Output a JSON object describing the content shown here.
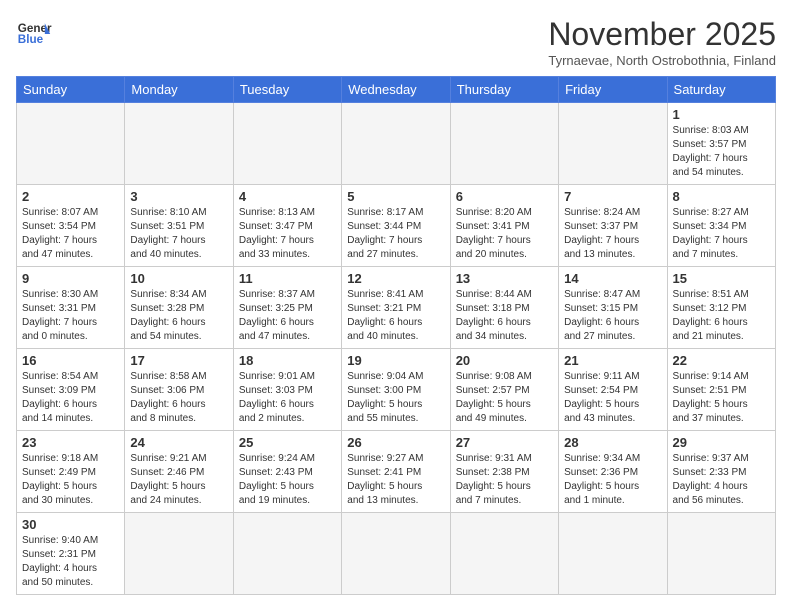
{
  "logo": {
    "text_general": "General",
    "text_blue": "Blue"
  },
  "title": "November 2025",
  "subtitle": "Tyrnaevae, North Ostrobothnia, Finland",
  "days_of_week": [
    "Sunday",
    "Monday",
    "Tuesday",
    "Wednesday",
    "Thursday",
    "Friday",
    "Saturday"
  ],
  "weeks": [
    [
      {
        "day": "",
        "info": ""
      },
      {
        "day": "",
        "info": ""
      },
      {
        "day": "",
        "info": ""
      },
      {
        "day": "",
        "info": ""
      },
      {
        "day": "",
        "info": ""
      },
      {
        "day": "",
        "info": ""
      },
      {
        "day": "1",
        "info": "Sunrise: 8:03 AM\nSunset: 3:57 PM\nDaylight: 7 hours\nand 54 minutes."
      }
    ],
    [
      {
        "day": "2",
        "info": "Sunrise: 8:07 AM\nSunset: 3:54 PM\nDaylight: 7 hours\nand 47 minutes."
      },
      {
        "day": "3",
        "info": "Sunrise: 8:10 AM\nSunset: 3:51 PM\nDaylight: 7 hours\nand 40 minutes."
      },
      {
        "day": "4",
        "info": "Sunrise: 8:13 AM\nSunset: 3:47 PM\nDaylight: 7 hours\nand 33 minutes."
      },
      {
        "day": "5",
        "info": "Sunrise: 8:17 AM\nSunset: 3:44 PM\nDaylight: 7 hours\nand 27 minutes."
      },
      {
        "day": "6",
        "info": "Sunrise: 8:20 AM\nSunset: 3:41 PM\nDaylight: 7 hours\nand 20 minutes."
      },
      {
        "day": "7",
        "info": "Sunrise: 8:24 AM\nSunset: 3:37 PM\nDaylight: 7 hours\nand 13 minutes."
      },
      {
        "day": "8",
        "info": "Sunrise: 8:27 AM\nSunset: 3:34 PM\nDaylight: 7 hours\nand 7 minutes."
      }
    ],
    [
      {
        "day": "9",
        "info": "Sunrise: 8:30 AM\nSunset: 3:31 PM\nDaylight: 7 hours\nand 0 minutes."
      },
      {
        "day": "10",
        "info": "Sunrise: 8:34 AM\nSunset: 3:28 PM\nDaylight: 6 hours\nand 54 minutes."
      },
      {
        "day": "11",
        "info": "Sunrise: 8:37 AM\nSunset: 3:25 PM\nDaylight: 6 hours\nand 47 minutes."
      },
      {
        "day": "12",
        "info": "Sunrise: 8:41 AM\nSunset: 3:21 PM\nDaylight: 6 hours\nand 40 minutes."
      },
      {
        "day": "13",
        "info": "Sunrise: 8:44 AM\nSunset: 3:18 PM\nDaylight: 6 hours\nand 34 minutes."
      },
      {
        "day": "14",
        "info": "Sunrise: 8:47 AM\nSunset: 3:15 PM\nDaylight: 6 hours\nand 27 minutes."
      },
      {
        "day": "15",
        "info": "Sunrise: 8:51 AM\nSunset: 3:12 PM\nDaylight: 6 hours\nand 21 minutes."
      }
    ],
    [
      {
        "day": "16",
        "info": "Sunrise: 8:54 AM\nSunset: 3:09 PM\nDaylight: 6 hours\nand 14 minutes."
      },
      {
        "day": "17",
        "info": "Sunrise: 8:58 AM\nSunset: 3:06 PM\nDaylight: 6 hours\nand 8 minutes."
      },
      {
        "day": "18",
        "info": "Sunrise: 9:01 AM\nSunset: 3:03 PM\nDaylight: 6 hours\nand 2 minutes."
      },
      {
        "day": "19",
        "info": "Sunrise: 9:04 AM\nSunset: 3:00 PM\nDaylight: 5 hours\nand 55 minutes."
      },
      {
        "day": "20",
        "info": "Sunrise: 9:08 AM\nSunset: 2:57 PM\nDaylight: 5 hours\nand 49 minutes."
      },
      {
        "day": "21",
        "info": "Sunrise: 9:11 AM\nSunset: 2:54 PM\nDaylight: 5 hours\nand 43 minutes."
      },
      {
        "day": "22",
        "info": "Sunrise: 9:14 AM\nSunset: 2:51 PM\nDaylight: 5 hours\nand 37 minutes."
      }
    ],
    [
      {
        "day": "23",
        "info": "Sunrise: 9:18 AM\nSunset: 2:49 PM\nDaylight: 5 hours\nand 30 minutes."
      },
      {
        "day": "24",
        "info": "Sunrise: 9:21 AM\nSunset: 2:46 PM\nDaylight: 5 hours\nand 24 minutes."
      },
      {
        "day": "25",
        "info": "Sunrise: 9:24 AM\nSunset: 2:43 PM\nDaylight: 5 hours\nand 19 minutes."
      },
      {
        "day": "26",
        "info": "Sunrise: 9:27 AM\nSunset: 2:41 PM\nDaylight: 5 hours\nand 13 minutes."
      },
      {
        "day": "27",
        "info": "Sunrise: 9:31 AM\nSunset: 2:38 PM\nDaylight: 5 hours\nand 7 minutes."
      },
      {
        "day": "28",
        "info": "Sunrise: 9:34 AM\nSunset: 2:36 PM\nDaylight: 5 hours\nand 1 minute."
      },
      {
        "day": "29",
        "info": "Sunrise: 9:37 AM\nSunset: 2:33 PM\nDaylight: 4 hours\nand 56 minutes."
      }
    ],
    [
      {
        "day": "30",
        "info": "Sunrise: 9:40 AM\nSunset: 2:31 PM\nDaylight: 4 hours\nand 50 minutes."
      },
      {
        "day": "",
        "info": ""
      },
      {
        "day": "",
        "info": ""
      },
      {
        "day": "",
        "info": ""
      },
      {
        "day": "",
        "info": ""
      },
      {
        "day": "",
        "info": ""
      },
      {
        "day": "",
        "info": ""
      }
    ]
  ]
}
